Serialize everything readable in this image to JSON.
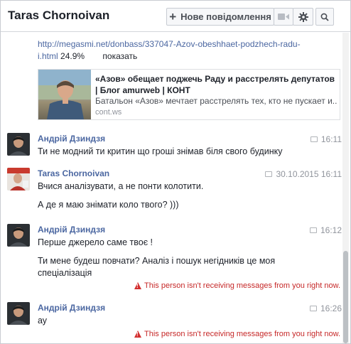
{
  "header": {
    "title": "Taras Chornoivan",
    "new_message_label": "Нове повідомлення",
    "video_icon": "video-camera-icon",
    "gear_icon": "gear-icon",
    "search_icon": "search-icon"
  },
  "link_preview": {
    "url": "http://megasmi.net/donbass/337047-Azov-obeshhaet-podzhech-radu-i.html",
    "percent": "24.9%",
    "show_label": "показать",
    "card_title": "«Азов» обещает поджечь Раду и расстрелять депутатов | Блог amurweb | КОНТ",
    "card_description": "Батальон «Азов» мечтает расстрелять тех, кто не пускает и...",
    "card_source": "cont.ws"
  },
  "messages": [
    {
      "sender": "Андрій Дзиндзя",
      "time": "16:11",
      "lines": [
        "Ти не модний ти критин що гроші знімав біля свого будинку"
      ]
    },
    {
      "sender": "Taras Chornoivan",
      "time": "30.10.2015 16:11",
      "lines": [
        "Вчися аналізувати, а не понти колотити.",
        "А де я маю знімати коло твого? )))"
      ]
    },
    {
      "sender": "Андрій Дзиндзя",
      "time": "16:12",
      "lines": [
        "Перше джерело саме твоє !",
        "Ти мене будеш повчати? Аналіз і пошук негідників це моя спеціалізація"
      ],
      "error": "This person isn't receiving messages from you right now."
    },
    {
      "sender": "Андрій Дзиндзя",
      "time": "16:26",
      "lines": [
        "ау"
      ],
      "error": "This person isn't receiving messages from you right now."
    }
  ],
  "colors": {
    "link": "#4b67a1",
    "error": "#c62828",
    "meta": "#90949c"
  }
}
